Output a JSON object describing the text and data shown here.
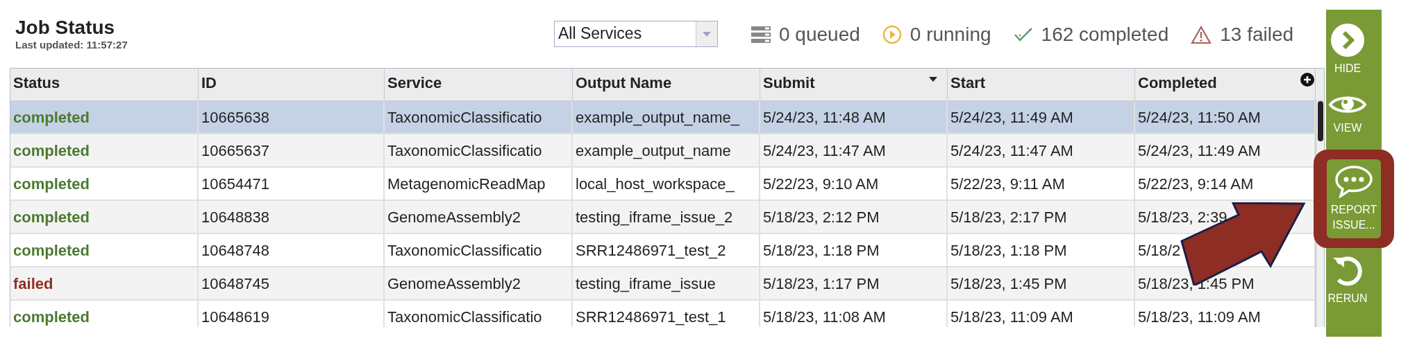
{
  "header": {
    "title": "Job Status",
    "last_updated": "Last updated: 11:57:27"
  },
  "service_filter": {
    "value": "All Services"
  },
  "stats": [
    {
      "kind": "queued",
      "text": "0 queued"
    },
    {
      "kind": "running",
      "text": "0 running"
    },
    {
      "kind": "completed",
      "text": "162 completed"
    },
    {
      "kind": "failed",
      "text": "13 failed"
    }
  ],
  "table": {
    "columns": [
      {
        "label": "Status",
        "sorted": false
      },
      {
        "label": "ID",
        "sorted": false
      },
      {
        "label": "Service",
        "sorted": false
      },
      {
        "label": "Output Name",
        "sorted": false
      },
      {
        "label": "Submit",
        "sorted": true
      },
      {
        "label": "Start",
        "sorted": false
      },
      {
        "label": "Completed",
        "sorted": false
      }
    ],
    "rows": [
      {
        "selected": true,
        "color": "#4b7a2e",
        "cells": [
          "completed",
          "10665638",
          "TaxonomicClassificatio",
          "example_output_name_",
          "5/24/23, 11:48 AM",
          "5/24/23, 11:49 AM",
          "5/24/23, 11:50 AM"
        ]
      },
      {
        "selected": false,
        "color": "#4b7a2e",
        "cells": [
          "completed",
          "10665637",
          "TaxonomicClassificatio",
          "example_output_name",
          "5/24/23, 11:47 AM",
          "5/24/23, 11:47 AM",
          "5/24/23, 11:49 AM"
        ]
      },
      {
        "selected": false,
        "color": "#4b7a2e",
        "cells": [
          "completed",
          "10654471",
          "MetagenomicReadMap",
          "local_host_workspace_",
          "5/22/23, 9:10 AM",
          "5/22/23, 9:11 AM",
          "5/22/23, 9:14 AM"
        ]
      },
      {
        "selected": false,
        "color": "#4b7a2e",
        "cells": [
          "completed",
          "10648838",
          "GenomeAssembly2",
          "testing_iframe_issue_2",
          "5/18/23, 2:12 PM",
          "5/18/23, 2:17 PM",
          "5/18/23, 2:39"
        ]
      },
      {
        "selected": false,
        "color": "#4b7a2e",
        "cells": [
          "completed",
          "10648748",
          "TaxonomicClassificatio",
          "SRR12486971_test_2",
          "5/18/23, 1:18 PM",
          "5/18/23, 1:18 PM",
          "5/18/2"
        ]
      },
      {
        "selected": false,
        "color": "#8e3022",
        "cells": [
          "failed",
          "10648745",
          "GenomeAssembly2",
          "testing_iframe_issue",
          "5/18/23, 1:17 PM",
          "5/18/23, 1:45 PM",
          "5/18/23, 1:45 PM"
        ]
      },
      {
        "selected": false,
        "color": "#4b7a2e",
        "cells": [
          "completed",
          "10648619",
          "TaxonomicClassificatio",
          "SRR12486971_test_1",
          "5/18/23, 11:08 AM",
          "5/18/23, 11:09 AM",
          "5/18/23, 11:09 AM"
        ]
      }
    ]
  },
  "actions": [
    {
      "kind": "hide",
      "label": "HIDE",
      "highlighted": false
    },
    {
      "kind": "view",
      "label": "VIEW",
      "highlighted": false
    },
    {
      "kind": "report",
      "label": "REPORT ISSUE...",
      "highlighted": true
    },
    {
      "kind": "rerun",
      "label": "RERUN",
      "highlighted": false
    }
  ],
  "pointer_arrow": {
    "shown": true
  }
}
